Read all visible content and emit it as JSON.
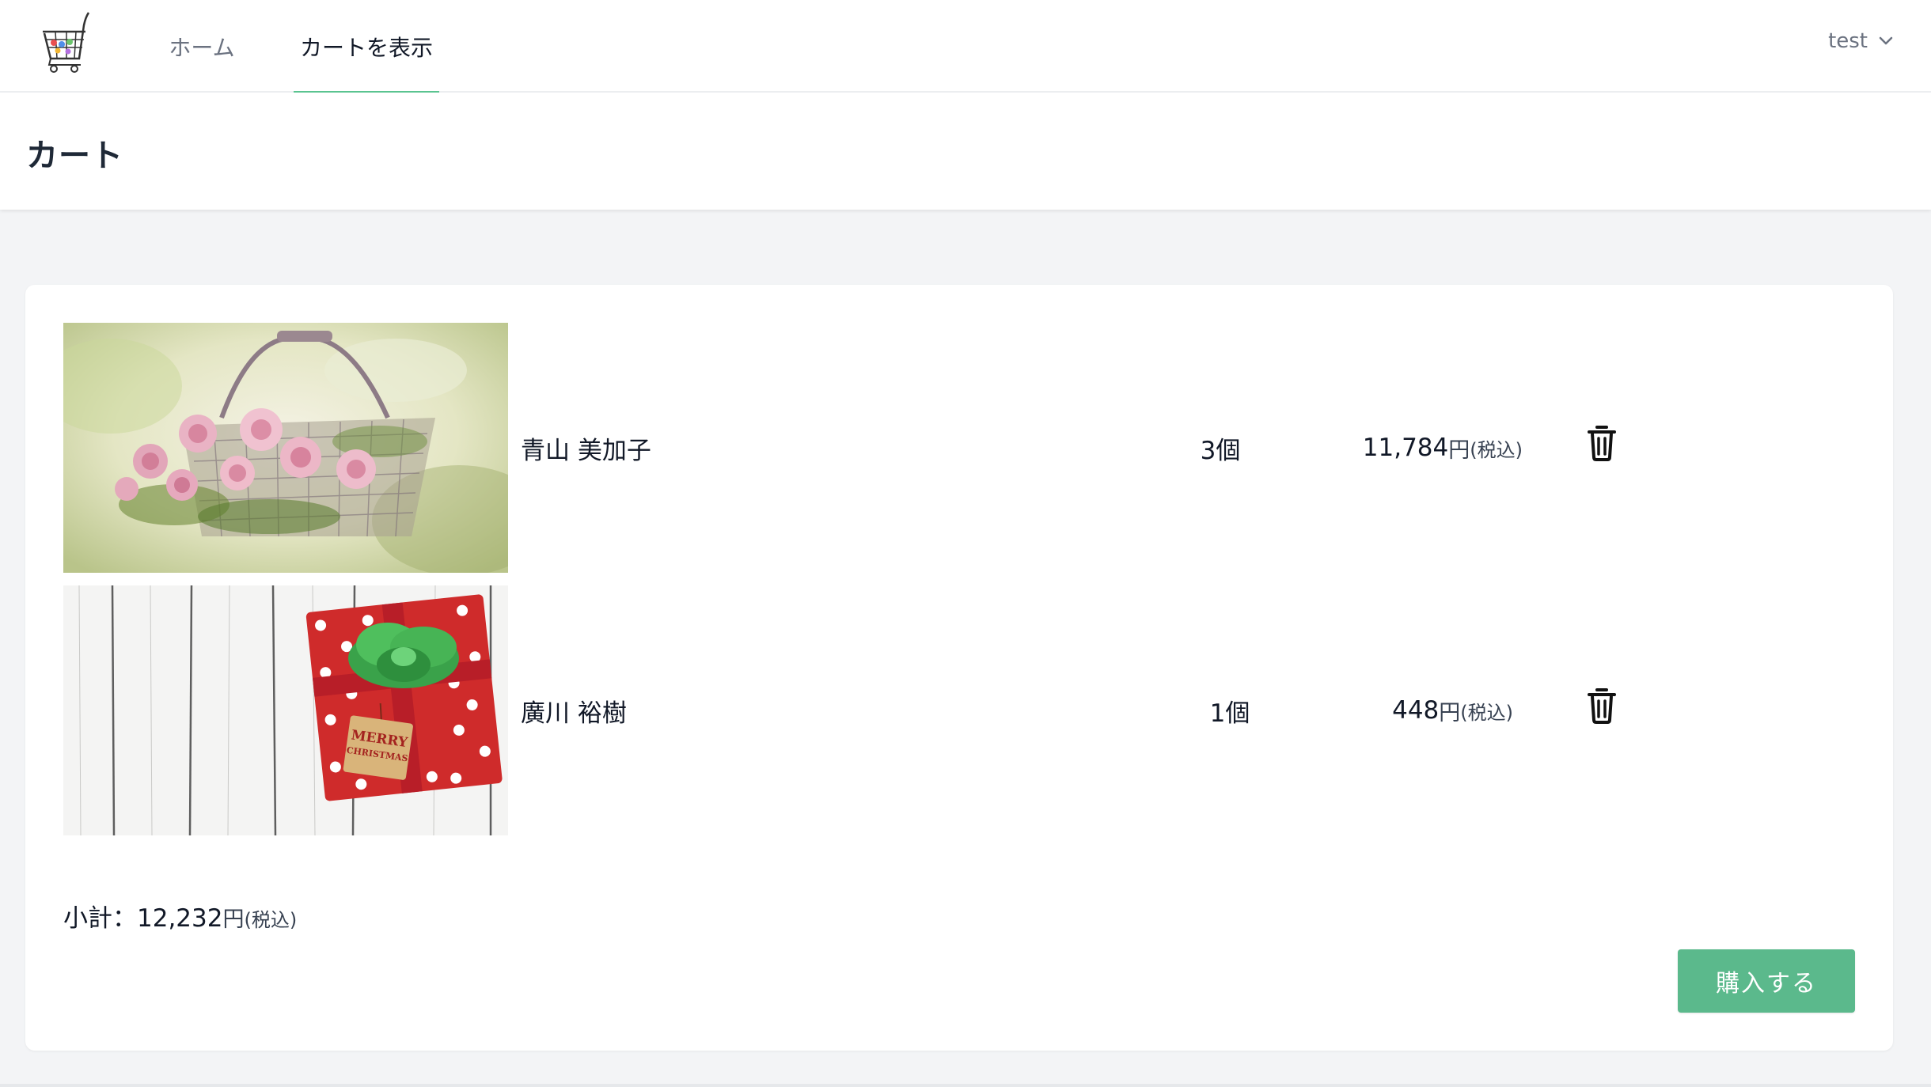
{
  "nav": {
    "logo_icon": "shopping-cart-logo",
    "home_label": "ホーム",
    "cart_label": "カートを表示",
    "active_color": "#5bc491",
    "user_label": "test",
    "user_chevron_icon": "chevron-down-icon"
  },
  "page": {
    "title": "カート"
  },
  "cart": {
    "items": [
      {
        "name": "青山 美加子",
        "qty": "3個",
        "price": "11,784",
        "currency": "円",
        "tax": "(税込)",
        "image_icon": "rose-basket-image",
        "delete_icon": "trash-icon"
      },
      {
        "name": "廣川 裕樹",
        "qty": "1個",
        "price": "448",
        "currency": "円",
        "tax": "(税込)",
        "image_icon": "christmas-gift-image",
        "image_text": "MERRY CHRISTMAS",
        "delete_icon": "trash-icon"
      }
    ],
    "subtotal_label": "小計：",
    "subtotal_value": "12,232",
    "subtotal_currency": "円",
    "subtotal_tax": "(税込)",
    "buy_label": "購入する",
    "buy_color": "#5bb98c"
  }
}
